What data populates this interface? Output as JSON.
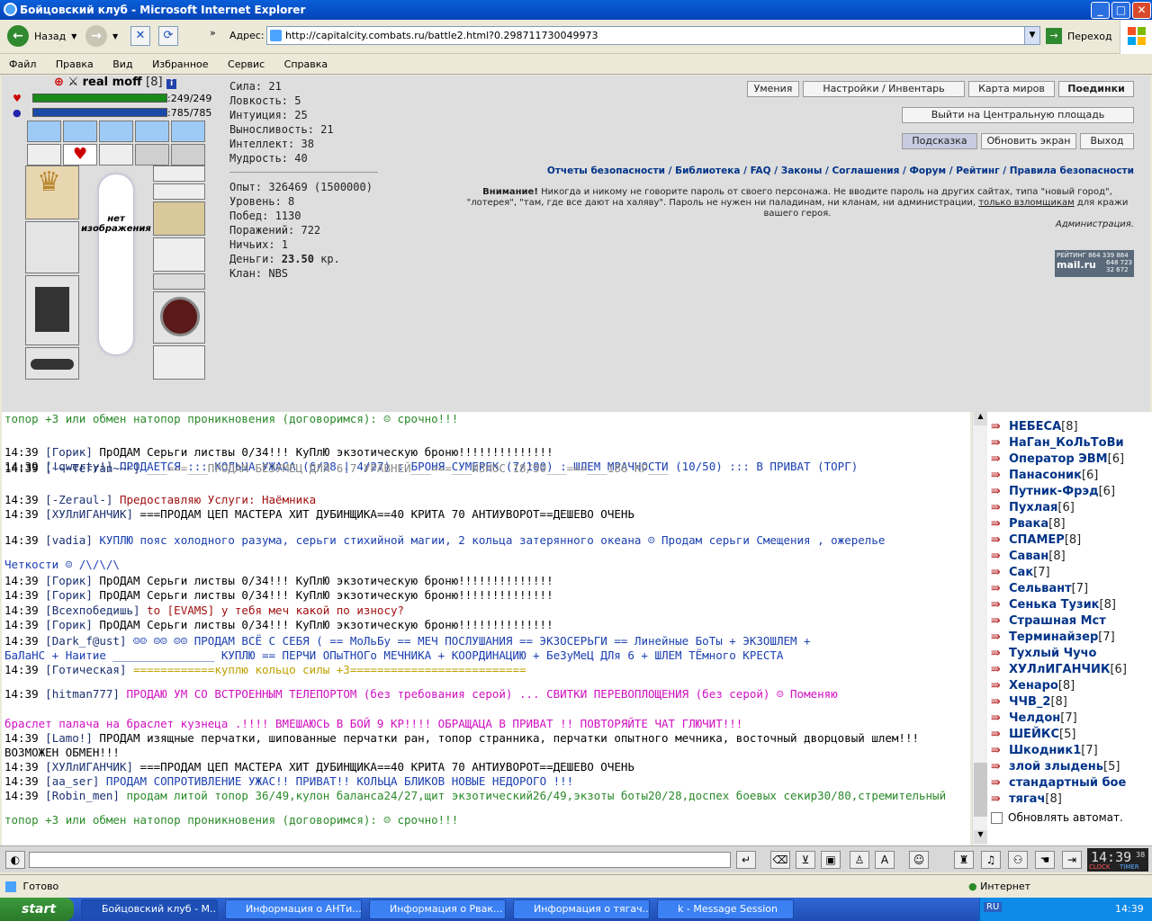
{
  "window": {
    "title": "Бойцовский клуб - Microsoft Internet Explorer"
  },
  "toolbar": {
    "back": "Назад",
    "address_label": "Адрес:",
    "url": "http://capitalcity.combats.ru/battle2.html?0.298711730049973",
    "go": "Переход"
  },
  "menu": [
    "Файл",
    "Правка",
    "Вид",
    "Избранное",
    "Сервис",
    "Справка"
  ],
  "character": {
    "name": "real moff",
    "level": "[8]",
    "hp": ":249/249",
    "mana": ":785/785",
    "no_image": "нет изображения"
  },
  "stats": [
    "Сила: 21",
    "Ловкость: 5",
    "Интуиция: 25",
    "Выносливость: 21",
    "Интеллект: 38",
    "Мудрость: 40"
  ],
  "info": [
    "Опыт: 326469 (1500000)",
    "Уровень: 8",
    "Побед: 1130",
    "Поражений: 722",
    "Ничьих: 1"
  ],
  "money_label": "Деньги: ",
  "money_value": "23.50",
  "money_unit": " кр.",
  "clan": "Клан: NBS",
  "buttons": {
    "skills": "Умения",
    "settings": "Настройки / Инвентарь",
    "map": "Карта миров",
    "fights": "Поединки",
    "exit_square": "Выйти на Центральную площадь",
    "hint": "Подсказка",
    "refresh": "Обновить экран",
    "exit": "Выход"
  },
  "links": "Отчеты безопасности / Библиотека / FAQ / Законы / Соглашения / Форум / Рейтинг / Правила безопасности",
  "warning_title": "Внимание!",
  "warning_text": " Никогда и никому не говорите пароль от своего персонажа. Не вводите пароль на других сайтах, типа \"новый город\", \"лотерея\", \"там, где все дают на халяву\". Пароль не нужен ни паладинам, ни кланам, ни администрации, ",
  "warning_link": "только взломщикам",
  "warning_end": " для кражи вашего героя.",
  "admin": "Администрация.",
  "rating": {
    "label": "РЕЙТИНГ",
    "n1": "864 339 884",
    "n2": "648 723",
    "n3": "32 672",
    "brand": "mail.ru"
  },
  "chat": [
    {
      "t": "",
      "n": "",
      "m": "топор +3 или обмен натопор проникновения (договоримся): ☺ срочно!!!",
      "c": "#2a8a2a"
    },
    {
      "t": "14:39",
      "n": "[Горик]",
      "m": "ПрОДАМ Серьги листвы 0/34!!! КуПлЮ экзотическую броню!!!!!!!!!!!!!!",
      "c": "#000"
    },
    {
      "t": "14:39",
      "n": "[!qwerty!]",
      "m": "ПРОДАЕТСЯ ::: КОЛЬЦА УЖАСА (6/28 | 4/27) : БРОНЯ СУМЕРЕК (7/100) : ШЛЕМ МРАЧНОСТИ (10/50) ::: В ПРИВАТ (ТОРГ)",
      "c": "#1a3fb0"
    },
    {
      "t": "14:39",
      "n": "[~~~Terran~~~]",
      "m": "___===___ПРОДАМ БЕЗУМЕЦ ДЛЯ 6-7 УРАВНЕЙ___===___ИЗНОС 18/50___===___186 КР___",
      "c": "#888"
    },
    {
      "t": "14:39",
      "n": "[-Zeraul-]",
      "m": "      Предоставляю Услуги: Наёмника",
      "c": "#a01010"
    },
    {
      "t": "14:39",
      "n": "[ХУЛлИГАНЧИК]",
      "m": "===ПРОДАМ ЦЕП МАСТЕРА ХИТ ДУБИНЩИКА==40 КРИТА 70 АНТИУВОРОТ==ДЕШЕВО ОЧЕНЬ",
      "c": "#000"
    },
    {
      "t": "14:39",
      "n": "[vadia]",
      "m": "   КУПЛЮ пояс холодного разума, серьги стихийной магии, 2 кольца затерянного океана ☺ Продам серьги Смещения , ожерелье",
      "c": "#1a3fb0"
    },
    {
      "t": "",
      "n": "",
      "m": "Четкости ☺ /\\/\\/\\",
      "c": "#1a3fb0"
    },
    {
      "t": "14:39",
      "n": "[Горик]",
      "m": "ПрОДАМ Серьги листвы 0/34!!! КуПлЮ экзотическую броню!!!!!!!!!!!!!!",
      "c": "#000"
    },
    {
      "t": "14:39",
      "n": "[Горик]",
      "m": "ПрОДАМ Серьги листвы 0/34!!! КуПлЮ экзотическую броню!!!!!!!!!!!!!!",
      "c": "#000"
    },
    {
      "t": "14:39",
      "n": "[Всехпобедишь]",
      "m": "to [EVAMS] у тебя меч какой по износу?",
      "c": "#a01010"
    },
    {
      "t": "14:39",
      "n": "[Горик]",
      "m": "ПрОДАМ Серьги листвы 0/34!!! КуПлЮ экзотическую броню!!!!!!!!!!!!!!",
      "c": "#000"
    },
    {
      "t": "14:39",
      "n": "[Dark_f@ust]",
      "m": "☺☺ ☺☺ ☺☺ ПРОДАМ ВСЁ С СЕБЯ ( == МоЛьБу == МЕЧ ПОСЛУШАНИЯ == ЭКЗОСЕРЬГИ == Линейные БоТы + ЭКЗОШЛЕМ +",
      "c": "#1a3fb0"
    },
    {
      "t": "",
      "n": "",
      "m": "БаЛаНС + Наитие _______________ КУПЛЮ == ПЕРЧИ ОПыТНОГо МЕЧНИКА + КООРДИНАЦИЮ + БеЗуМеЦ ДЛя 6 + ШЛЕМ ТЁмного КРЕСТА",
      "c": "#1a3fb0"
    },
    {
      "t": "14:39",
      "n": "[Готическая]",
      "m": "============куплю кольцо силы +3==========================",
      "c": "#c0a000"
    },
    {
      "t": "14:39",
      "n": "[hitman777]",
      "m": "    ПРОДАЮ УМ СО ВСТРОЕННЫМ ТЕЛЕПОРТОМ (без требования серой) ... СВИТКИ ПЕРЕВОПЛОЩЕНИЯ (без серой) ☺ Поменяю",
      "c": "#d010c0"
    },
    {
      "t": "",
      "n": "",
      "m": "браслет палача на браслет кузнеца .!!!! ВМЕШАЮСЬ В БОЙ 9 КР!!!!       ОБРАЩАЦА В ПРИВАТ !! ПОВТОРЯЙТЕ ЧАТ ГЛЮЧИТ!!!",
      "c": "#d010c0"
    },
    {
      "t": "14:39",
      "n": "[Lamo!]",
      "m": "ПРОДАМ изящные перчатки, шипованные перчатки ран, топор странника, перчатки опытного мечника, восточный дворцовый шлем!!!",
      "c": "#000"
    },
    {
      "t": "",
      "n": "",
      "m": "ВОЗМОЖЕН ОБМЕН!!!",
      "c": "#000"
    },
    {
      "t": "14:39",
      "n": "[ХУЛлИГАНЧИК]",
      "m": "===ПРОДАМ ЦЕП МАСТЕРА ХИТ ДУБИНЩИКА==40 КРИТА 70 АНТИУВОРОТ==ДЕШЕВО ОЧЕНЬ",
      "c": "#000"
    },
    {
      "t": "14:39",
      "n": "[aa_ser]",
      "m": "ПРОДАМ СОПРОТИВЛЕНИЕ УЖАС!! ПРИВАТ!! КОЛЬЦА БЛИКОВ НОВЫЕ НЕДОРОГО !!!",
      "c": "#1a3fb0"
    },
    {
      "t": "14:39",
      "n": "[Robin_men]",
      "m": "продам литой топор 36/49,кулон баланса24/27,щит экзотический26/49,экзоты боты20/28,доспех боевых секир30/80,стремительный",
      "c": "#2a8a2a"
    },
    {
      "t": "",
      "n": "",
      "m": "топор +3 или обмен натопор проникновения (договоримся): ☺ срочно!!!",
      "c": "#2a8a2a"
    }
  ],
  "online": [
    {
      "name": "НЕБЕСА",
      "lvl": "[8]"
    },
    {
      "name": "НаГан_КоЛьТоВи",
      "lvl": ""
    },
    {
      "name": "Оператор ЭВМ",
      "lvl": "[6]"
    },
    {
      "name": "Панасоник",
      "lvl": "[6]"
    },
    {
      "name": "Путник-Фрэд",
      "lvl": "[6]"
    },
    {
      "name": "Пухлая",
      "lvl": "[6]"
    },
    {
      "name": "Рвака",
      "lvl": "[8]"
    },
    {
      "name": "СПАМЕР",
      "lvl": "[8]"
    },
    {
      "name": "Саван",
      "lvl": "[8]"
    },
    {
      "name": "Сак",
      "lvl": "[7]"
    },
    {
      "name": "Сельвант",
      "lvl": "[7]"
    },
    {
      "name": "Сенька Тузик",
      "lvl": "[8]"
    },
    {
      "name": "Страшная Мст",
      "lvl": ""
    },
    {
      "name": "Терминайзер",
      "lvl": "[7]"
    },
    {
      "name": "Тухлый Чучо",
      "lvl": ""
    },
    {
      "name": "ХУЛлИГАНЧИК",
      "lvl": "[6]"
    },
    {
      "name": "Хенаро",
      "lvl": "[8]"
    },
    {
      "name": "ЧЧВ_2",
      "lvl": "[8]"
    },
    {
      "name": "Челдон",
      "lvl": "[7]"
    },
    {
      "name": "ШЕЙКС",
      "lvl": "[5]"
    },
    {
      "name": "Шкодник1",
      "lvl": "[7]"
    },
    {
      "name": "злой злыдень",
      "lvl": "[5]"
    },
    {
      "name": "стандартный бое",
      "lvl": ""
    },
    {
      "name": "тягач",
      "lvl": "[8]"
    }
  ],
  "auto_refresh": "Обновлять автомат.",
  "clock": {
    "time": "14:39",
    "sec": "38",
    "clock_label": "CLOCK",
    "timer_label": "TIMER"
  },
  "statusbar": {
    "ready": "Готово",
    "zone": "Интернет"
  },
  "taskbar": {
    "start": "start",
    "tasks": [
      "Бойцовский клуб - М...",
      "Информация о АНТи...",
      "Информация о Рвак...",
      "Информация о тягач...",
      "k - Message Session"
    ],
    "lang": "RU",
    "time": "14:39"
  }
}
